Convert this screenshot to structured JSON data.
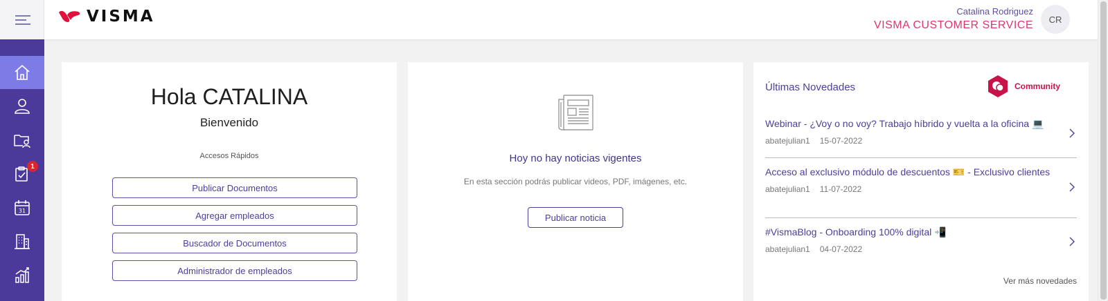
{
  "header": {
    "logo_text": "VISMA",
    "user_name": "Catalina Rodriguez",
    "user_org": "VISMA CUSTOMER SERVICE",
    "avatar_initials": "CR"
  },
  "sidebar": {
    "items": [
      {
        "icon": "home-icon",
        "active": true
      },
      {
        "icon": "user-icon",
        "active": false
      },
      {
        "icon": "folder-user-icon",
        "active": false
      },
      {
        "icon": "clipboard-check-icon",
        "active": false,
        "badge": "1"
      },
      {
        "icon": "calendar-icon",
        "active": false,
        "day": "31"
      },
      {
        "icon": "building-icon",
        "active": false
      },
      {
        "icon": "chart-icon",
        "active": false
      }
    ]
  },
  "welcome_card": {
    "greeting": "Hola CATALINA",
    "subtitle": "Bienvenido",
    "quick_access_title": "Accesos Rápidos",
    "buttons": [
      "Publicar Documentos",
      "Agregar empleados",
      "Buscador de Documentos",
      "Administrador de empleados"
    ]
  },
  "news_card": {
    "icon": "newspaper-icon",
    "title": "Hoy no hay noticias vigentes",
    "description": "En esta sección podrás publicar videos, PDF, imágenes, etc.",
    "button": "Publicar noticia"
  },
  "updates_card": {
    "title": "Últimas Novedades",
    "community_label": "Community",
    "items": [
      {
        "title": "Webinar - ¿Voy o no voy? Trabajo híbrido y vuelta a la oficina 💻",
        "author": "abatejulian1",
        "date": "15-07-2022"
      },
      {
        "title": "Acceso al exclusivo módulo de descuentos 🎫 - Exclusivo clientes",
        "author": "abatejulian1",
        "date": "11-07-2022"
      },
      {
        "title": "#VismaBlog - Onboarding 100% digital 📲",
        "author": "abatejulian1",
        "date": "04-07-2022"
      }
    ],
    "see_more": "Ver más novedades"
  },
  "colors": {
    "sidebar": "#4b3a99",
    "sidebar_active": "#7d7ce6",
    "accent": "#4b3e9c",
    "brand_pink": "#e0356a",
    "badge": "#d8262c"
  }
}
